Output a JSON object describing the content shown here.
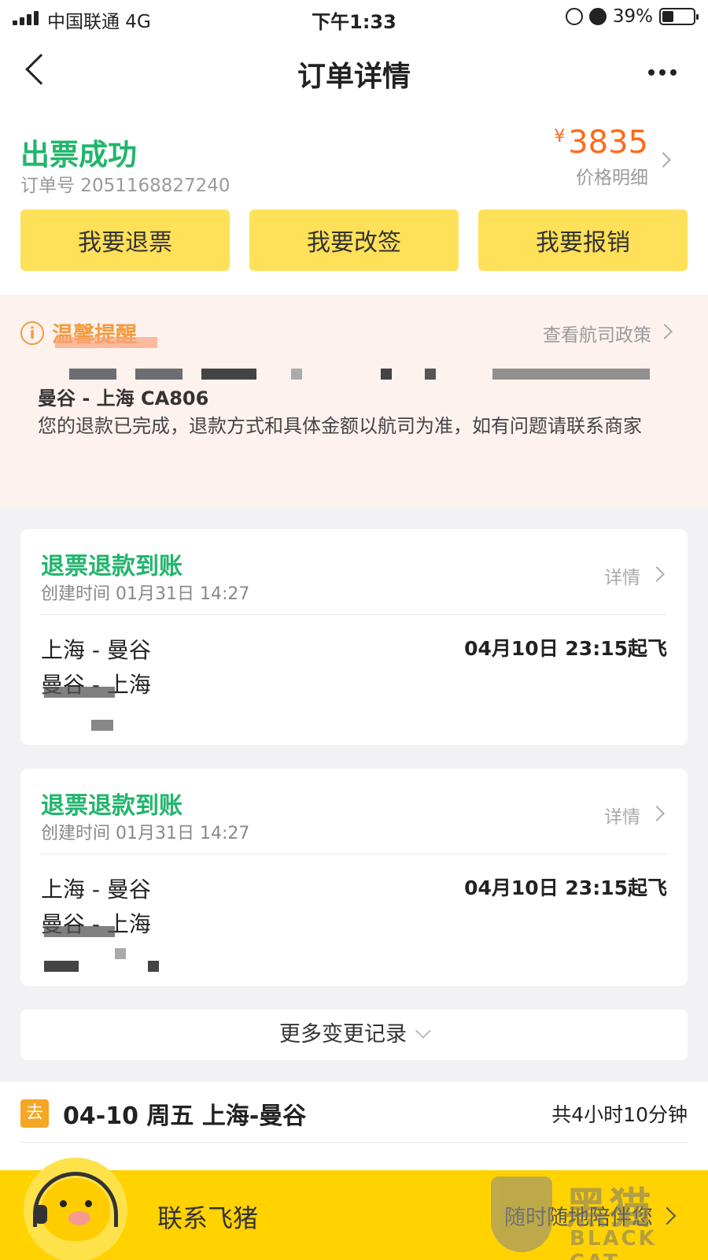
{
  "status_bar": {
    "carrier": "中国联通  4G",
    "time": "下午1:33",
    "battery": "39%"
  },
  "nav": {
    "title": "订单详情"
  },
  "order": {
    "status": "出票成功",
    "order_no": "订单号 2051168827240",
    "currency": "¥",
    "price": "3835",
    "price_label": "价格明细",
    "actions": [
      "我要退票",
      "我要改签",
      "我要报销"
    ]
  },
  "notice": {
    "icon_text": "i",
    "title": "温馨提醒",
    "link": "查看航司政策",
    "route": "曼谷 - 上海 CA806",
    "text": "您的退款已完成，退款方式和具体金额以航司为准，如有问题请联系商家"
  },
  "refunds": [
    {
      "title": "退票退款到账",
      "created": "创建时间 01月31日 14:27",
      "detail": "详情",
      "line1": "上海 - 曼谷",
      "line2": "曼谷 - 上海",
      "departure": "04月10日 23:15起飞"
    },
    {
      "title": "退票退款到账",
      "created": "创建时间 01月31日 14:27",
      "detail": "详情",
      "line1": "上海 - 曼谷",
      "line2": "曼谷 - 上海",
      "departure": "04月10日 23:15起飞"
    }
  ],
  "more_records": "更多变更记录",
  "itinerary": {
    "tag": "去",
    "route": "04-10 周五 上海-曼谷",
    "duration": "共4小时10分钟"
  },
  "contact": {
    "title": "联系飞猪",
    "subtitle": "随时随地陪伴您"
  },
  "watermark": {
    "cn": "黑猫",
    "en": "BLACK CAT"
  },
  "colors": {
    "success": "#22b56d",
    "price": "#ff6a1a",
    "button": "#ffe059",
    "notice_bg": "#fdf2ee",
    "notice_accent": "#f39b3e",
    "contact_bar": "#ffd200"
  }
}
